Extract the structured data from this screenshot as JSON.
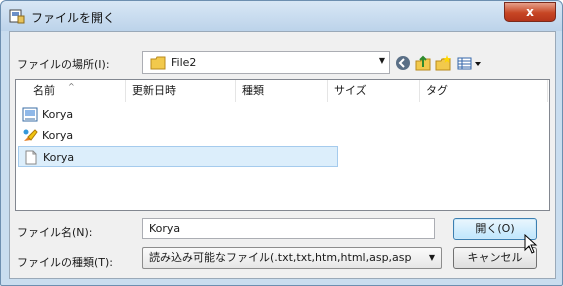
{
  "window": {
    "title": "ファイルを開く",
    "close_label": "x",
    "accent_color": "#c74624"
  },
  "location": {
    "label": "ファイルの場所(I):",
    "value": "File2"
  },
  "toolbar": {
    "icons": [
      "back-icon",
      "up-folder-icon",
      "new-folder-icon",
      "view-menu-icon"
    ]
  },
  "file_list": {
    "columns": [
      "名前",
      "更新日時",
      "種類",
      "サイズ",
      "タグ"
    ],
    "rows": [
      {
        "name": "Korya",
        "icon": "image-file-icon",
        "selected": false
      },
      {
        "name": "Korya",
        "icon": "paint-file-icon",
        "selected": false
      },
      {
        "name": "Korya",
        "icon": "blank-file-icon",
        "selected": true
      }
    ]
  },
  "file_name": {
    "label": "ファイル名(N):",
    "value": "Korya"
  },
  "file_type": {
    "label": "ファイルの種類(T):",
    "value": "読み込み可能なファイル(.txt,txt,htm,html,asp,asp"
  },
  "buttons": {
    "open": "開く(O)",
    "cancel": "キャンセル"
  }
}
